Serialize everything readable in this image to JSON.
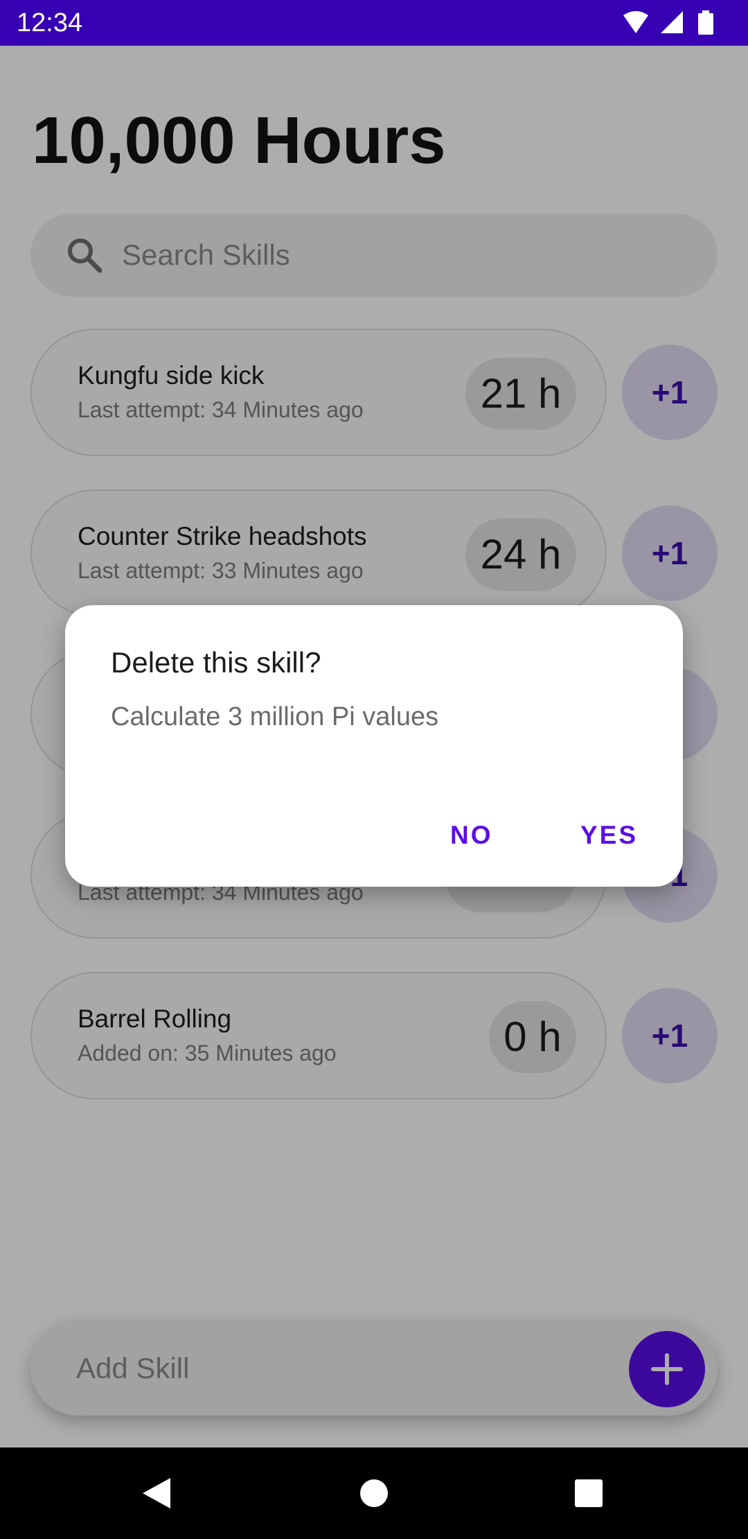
{
  "status_bar": {
    "time": "12:34",
    "icons": [
      "wifi-icon",
      "cellular-signal-icon",
      "battery-icon"
    ],
    "background": "#3700b3"
  },
  "app": {
    "title": "10,000 Hours"
  },
  "search": {
    "placeholder": "Search Skills",
    "icon": "search-icon"
  },
  "skills": [
    {
      "name": "Kungfu side kick",
      "subtitle": "Last attempt: 34 Minutes ago",
      "hours": "21 h",
      "increment_label": "+1"
    },
    {
      "name": "Counter Strike headshots",
      "subtitle": "Last attempt: 33 Minutes ago",
      "hours": "24 h",
      "increment_label": "+1"
    },
    {
      "name": "",
      "subtitle": "",
      "hours": "",
      "increment_label": ""
    },
    {
      "name": "",
      "subtitle": "Last attempt: 34 Minutes ago",
      "hours": "",
      "increment_label": "+1"
    },
    {
      "name": "Barrel Rolling",
      "subtitle": "Added on: 35 Minutes ago",
      "hours": "0 h",
      "increment_label": "+1"
    }
  ],
  "add_skill": {
    "placeholder": "Add Skill",
    "button_icon": "plus-icon"
  },
  "dialog": {
    "title": "Delete this skill?",
    "message": "Calculate 3 million Pi values",
    "negative_label": "NO",
    "positive_label": "YES"
  },
  "navigation_bar": {
    "icons": [
      "back-icon",
      "home-icon",
      "recents-icon"
    ]
  },
  "colors": {
    "accent": "#5b0ee8",
    "status_bar": "#3700b3",
    "increment_button_bg": "#e3dcf4"
  }
}
